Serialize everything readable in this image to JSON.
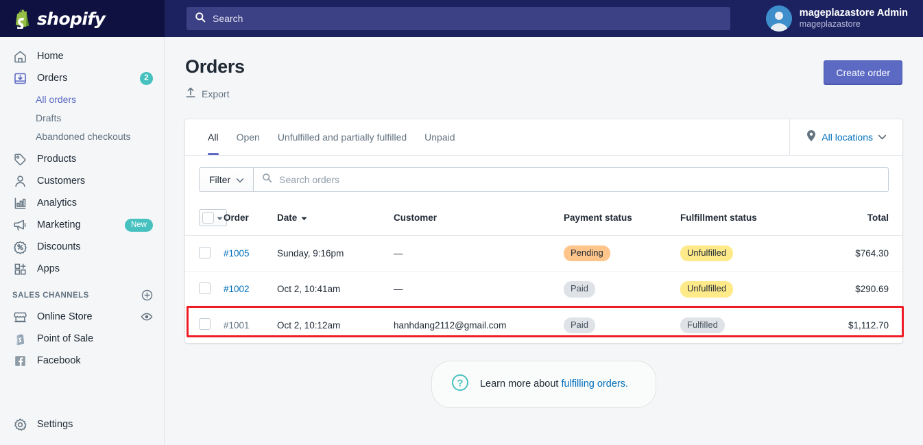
{
  "topbar": {
    "brand_name": "shopify",
    "search_placeholder": "Search",
    "user_name": "mageplazastore Admin",
    "user_store": "mageplazastore"
  },
  "sidebar": {
    "items": [
      {
        "label": "Home",
        "icon": "home-icon",
        "badge": null,
        "active": false
      },
      {
        "label": "Orders",
        "icon": "orders-icon",
        "badge": "2",
        "active": false
      },
      {
        "label": "Products",
        "icon": "products-tag-icon",
        "badge": null,
        "active": false
      },
      {
        "label": "Customers",
        "icon": "customers-person-icon",
        "badge": null,
        "active": false
      },
      {
        "label": "Analytics",
        "icon": "analytics-bars-icon",
        "badge": null,
        "active": false
      },
      {
        "label": "Marketing",
        "icon": "marketing-megaphone-icon",
        "badge": "New",
        "active": false
      },
      {
        "label": "Discounts",
        "icon": "discounts-percent-icon",
        "badge": null,
        "active": false
      },
      {
        "label": "Apps",
        "icon": "apps-grid-plus-icon",
        "badge": null,
        "active": false
      }
    ],
    "sub_items": [
      {
        "label": "All orders",
        "active": true
      },
      {
        "label": "Drafts",
        "active": false
      },
      {
        "label": "Abandoned checkouts",
        "active": false
      }
    ],
    "section_title": "SALES CHANNELS",
    "channels": [
      {
        "label": "Online Store",
        "icon": "storefront-icon",
        "trailing_icon": "eye-icon"
      },
      {
        "label": "Point of Sale",
        "icon": "pos-bag-icon",
        "trailing_icon": null
      },
      {
        "label": "Facebook",
        "icon": "facebook-icon",
        "trailing_icon": null
      }
    ],
    "settings": {
      "label": "Settings",
      "icon": "gear-icon"
    }
  },
  "page": {
    "title": "Orders",
    "export_label": "Export",
    "create_order_label": "Create order"
  },
  "tabs": [
    {
      "label": "All",
      "active": true
    },
    {
      "label": "Open",
      "active": false
    },
    {
      "label": "Unfulfilled and partially fulfilled",
      "active": false
    },
    {
      "label": "Unpaid",
      "active": false
    }
  ],
  "locations": {
    "label": "All locations"
  },
  "filter": {
    "filter_label": "Filter",
    "search_placeholder": "Search orders"
  },
  "table": {
    "columns": [
      {
        "key": "order",
        "label": "Order"
      },
      {
        "key": "date",
        "label": "Date",
        "sorted": true
      },
      {
        "key": "customer",
        "label": "Customer"
      },
      {
        "key": "payment_status",
        "label": "Payment status"
      },
      {
        "key": "fulfillment_status",
        "label": "Fulfillment status"
      },
      {
        "key": "total",
        "label": "Total"
      }
    ],
    "rows": [
      {
        "order": "#1005",
        "order_state": "link",
        "date": "Sunday, 9:16pm",
        "customer": "—",
        "customer_muted": true,
        "payment_status": "Pending",
        "payment_variant": "pending",
        "fulfillment_status": "Unfulfilled",
        "fulfillment_variant": "unfulfilled",
        "total": "$764.30",
        "highlighted": false
      },
      {
        "order": "#1002",
        "order_state": "link",
        "date": "Oct 2, 10:41am",
        "customer": "—",
        "customer_muted": true,
        "payment_status": "Paid",
        "payment_variant": "paid",
        "fulfillment_status": "Unfulfilled",
        "fulfillment_variant": "unfulfilled",
        "total": "$290.69",
        "highlighted": false
      },
      {
        "order": "#1001",
        "order_state": "visited",
        "date": "Oct 2, 10:12am",
        "customer": "hanhdang2112@gmail.com",
        "customer_muted": false,
        "payment_status": "Paid",
        "payment_variant": "paid",
        "fulfillment_status": "Fulfilled",
        "fulfillment_variant": "fulfilled",
        "total": "$1,112.70",
        "highlighted": true
      }
    ]
  },
  "help": {
    "text": "Learn more about ",
    "link": "fulfilling orders."
  },
  "colors": {
    "brand_dark": "#0f1140",
    "topbar": "#1c2260",
    "accent_purple": "#5c6ac4",
    "link_blue": "#006fbb",
    "teal": "#47c1bf",
    "pending": "#ffc58b",
    "unfulfilled": "#ffea8a",
    "neutral_pill": "#dfe3e8",
    "highlight_red": "#ee1c25"
  }
}
